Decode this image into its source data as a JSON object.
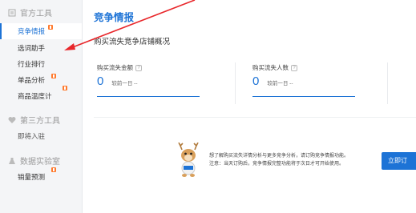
{
  "sidebar": {
    "section_official": "官方工具",
    "section_third": "第三方工具",
    "section_lab": "数据实验室",
    "items": [
      {
        "label": "竞争情报",
        "active": true,
        "badge": true
      },
      {
        "label": "选词助手",
        "active": false,
        "badge": false
      },
      {
        "label": "行业排行",
        "active": false,
        "badge": false
      },
      {
        "label": "单品分析",
        "active": false,
        "badge": true
      },
      {
        "label": "商品温度计",
        "active": false,
        "badge": true
      },
      {
        "label": "即将入驻",
        "active": false,
        "badge": false
      },
      {
        "label": "销量预测",
        "active": false,
        "badge": true
      }
    ]
  },
  "main": {
    "title": "竞争情报",
    "subtitle": "购买流失竞争店铺概况",
    "metrics": [
      {
        "label": "购买流失金额",
        "value": "0",
        "compare": "较前一日 --"
      },
      {
        "label": "购买流失人数",
        "value": "0",
        "compare": "较前一日 --"
      }
    ],
    "help_icon": "?",
    "promo_line1": "想了解购买流失详情分析与更多竞争分析，请订购竞争情报功能。",
    "promo_line2": "注意：当天订购后，竞争情报完整功能将于次日才可开始使用。",
    "buy_button": "立即订"
  },
  "colors": {
    "accent": "#1d73d6",
    "badge": "#ff7a2e",
    "annotation_arrow": "#e8262a"
  }
}
